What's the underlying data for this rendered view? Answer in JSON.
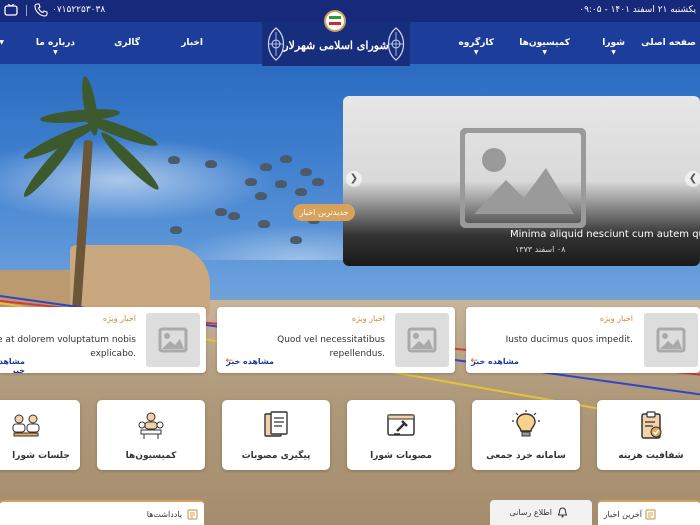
{
  "topbar": {
    "date": "یکشنبه ۲۱ اسفند ۱۴۰۱ - ۰۹:۰۵",
    "phone": "۰۷۱۵۲۲۵۳۰۳۸"
  },
  "nav": {
    "items": [
      {
        "label": "صفحه اصلی",
        "has_dropdown": false
      },
      {
        "label": "شورا",
        "has_dropdown": true
      },
      {
        "label": "کمیسیون‌ها",
        "has_dropdown": true
      },
      {
        "label": "کارگروه",
        "has_dropdown": true
      },
      {
        "label": "اخبار",
        "has_dropdown": false
      },
      {
        "label": "گالری",
        "has_dropdown": false
      },
      {
        "label": "درباره ما",
        "has_dropdown": true
      }
    ],
    "logo_title": "شورای اسلامی شهرلار"
  },
  "slider": {
    "badge": "جدیدترین اخبار",
    "title": "Minima aliquid nesciunt cum autem quo.",
    "date": "۰۸ اسفند ۱۳۷۳",
    "prev_icon": "chevron-left-icon",
    "next_icon": "chevron-right-icon"
  },
  "featured": [
    {
      "tag": "اخبار ویژه",
      "text": "Iusto ducimus quos impedit.",
      "more": "مشاهده خبر"
    },
    {
      "tag": "اخبار ویژه",
      "text": "Quod vel necessitatibus repellendus.",
      "more": "مشاهده خبر"
    },
    {
      "tag": "اخبار ویژه",
      "text": "Molestiae at dolorem voluptatum nobis explicabo.",
      "more": "مشاهده خبر"
    }
  ],
  "services": [
    {
      "label": "شفافیت هزینه",
      "icon": "clipboard-check-icon"
    },
    {
      "label": "سامانه خرد جمعی",
      "icon": "lightbulb-icon"
    },
    {
      "label": "مصوبات شورا",
      "icon": "gavel-icon"
    },
    {
      "label": "پیگیری مصوبات",
      "icon": "documents-icon"
    },
    {
      "label": "کمیسیون‌ها",
      "icon": "meeting-icon"
    },
    {
      "label": "جلسات شورا",
      "icon": "group-icon"
    }
  ],
  "bottom_tabs": [
    {
      "label": "آخرین اخبار",
      "icon": "news-icon"
    },
    {
      "label": "اطلاع رسانی",
      "icon": "bell-icon"
    },
    {
      "label": "یادداشت‌ها",
      "icon": "notes-icon"
    }
  ],
  "colors": {
    "nav_bg": "#1d3d9a",
    "topbar_bg": "#16297a",
    "accent": "#d7a25c",
    "link": "#1d3d9a",
    "arrow": "#d0562a"
  }
}
